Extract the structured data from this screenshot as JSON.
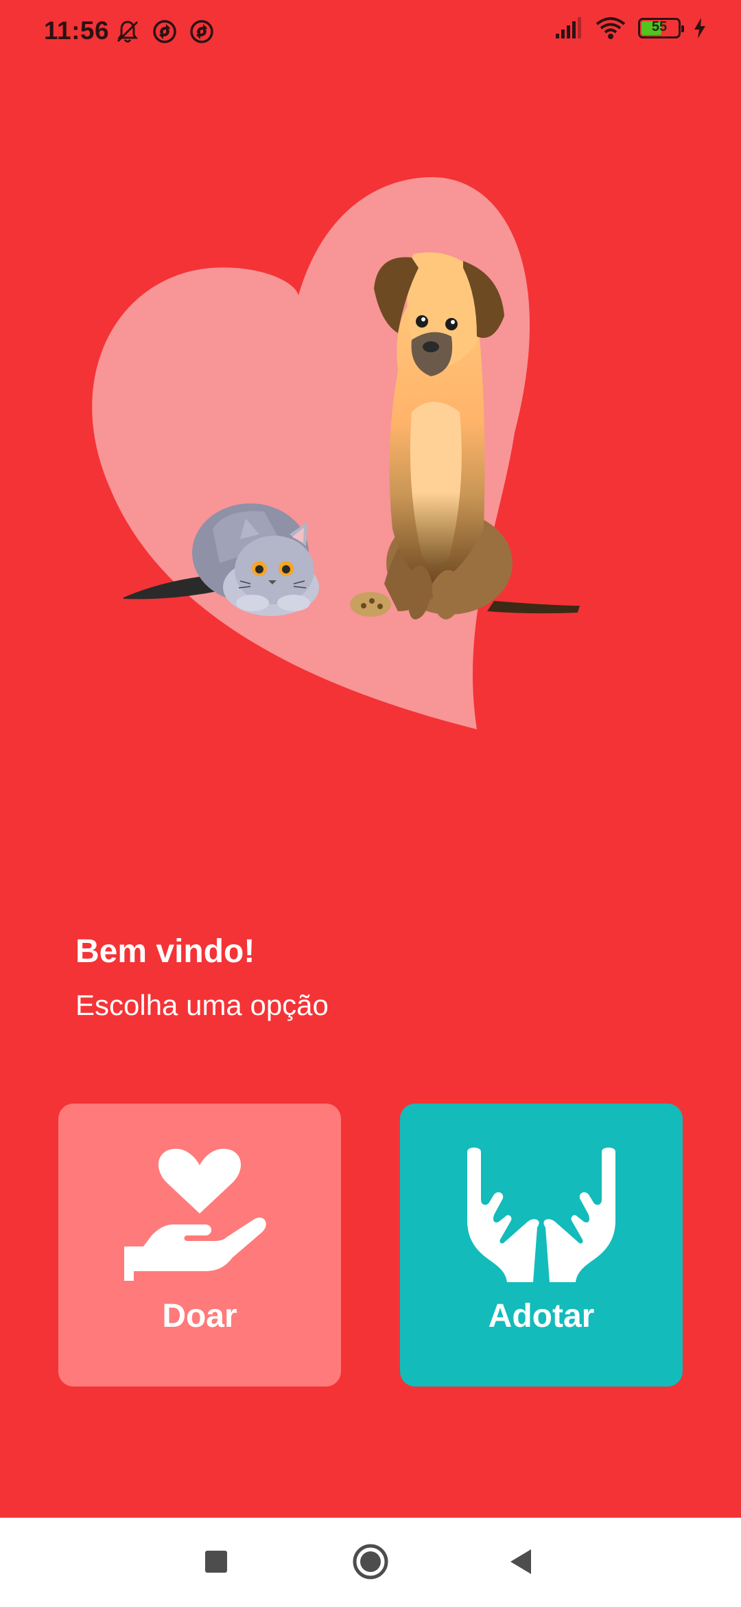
{
  "status_bar": {
    "time": "11:56",
    "battery_level": "55",
    "battery_fraction": 0.55,
    "left_icons": [
      "notifications-muted-icon",
      "sync-icon",
      "sync-icon"
    ],
    "right_icons": [
      "cellular-signal-icon",
      "wifi-icon",
      "battery-icon",
      "charging-bolt-icon"
    ]
  },
  "hero": {
    "image": "heart-with-cat-and-dog-illustration"
  },
  "greeting": {
    "title": "Bem vindo!",
    "subtitle": "Escolha uma opção"
  },
  "options": [
    {
      "label": "Doar",
      "icon": "hand-holding-heart-icon",
      "color": "#FF7A7A"
    },
    {
      "label": "Adotar",
      "icon": "open-hands-icon",
      "color": "#13BBBB"
    }
  ],
  "nav_bar": {
    "buttons": [
      "recents-square-icon",
      "home-circle-icon",
      "back-triangle-icon"
    ]
  },
  "colors": {
    "background": "#F43336",
    "heart": "#F89597",
    "donate_card": "#FF7A7A",
    "adopt_card": "#13BBBB",
    "nav_background": "#FFFFFF"
  }
}
